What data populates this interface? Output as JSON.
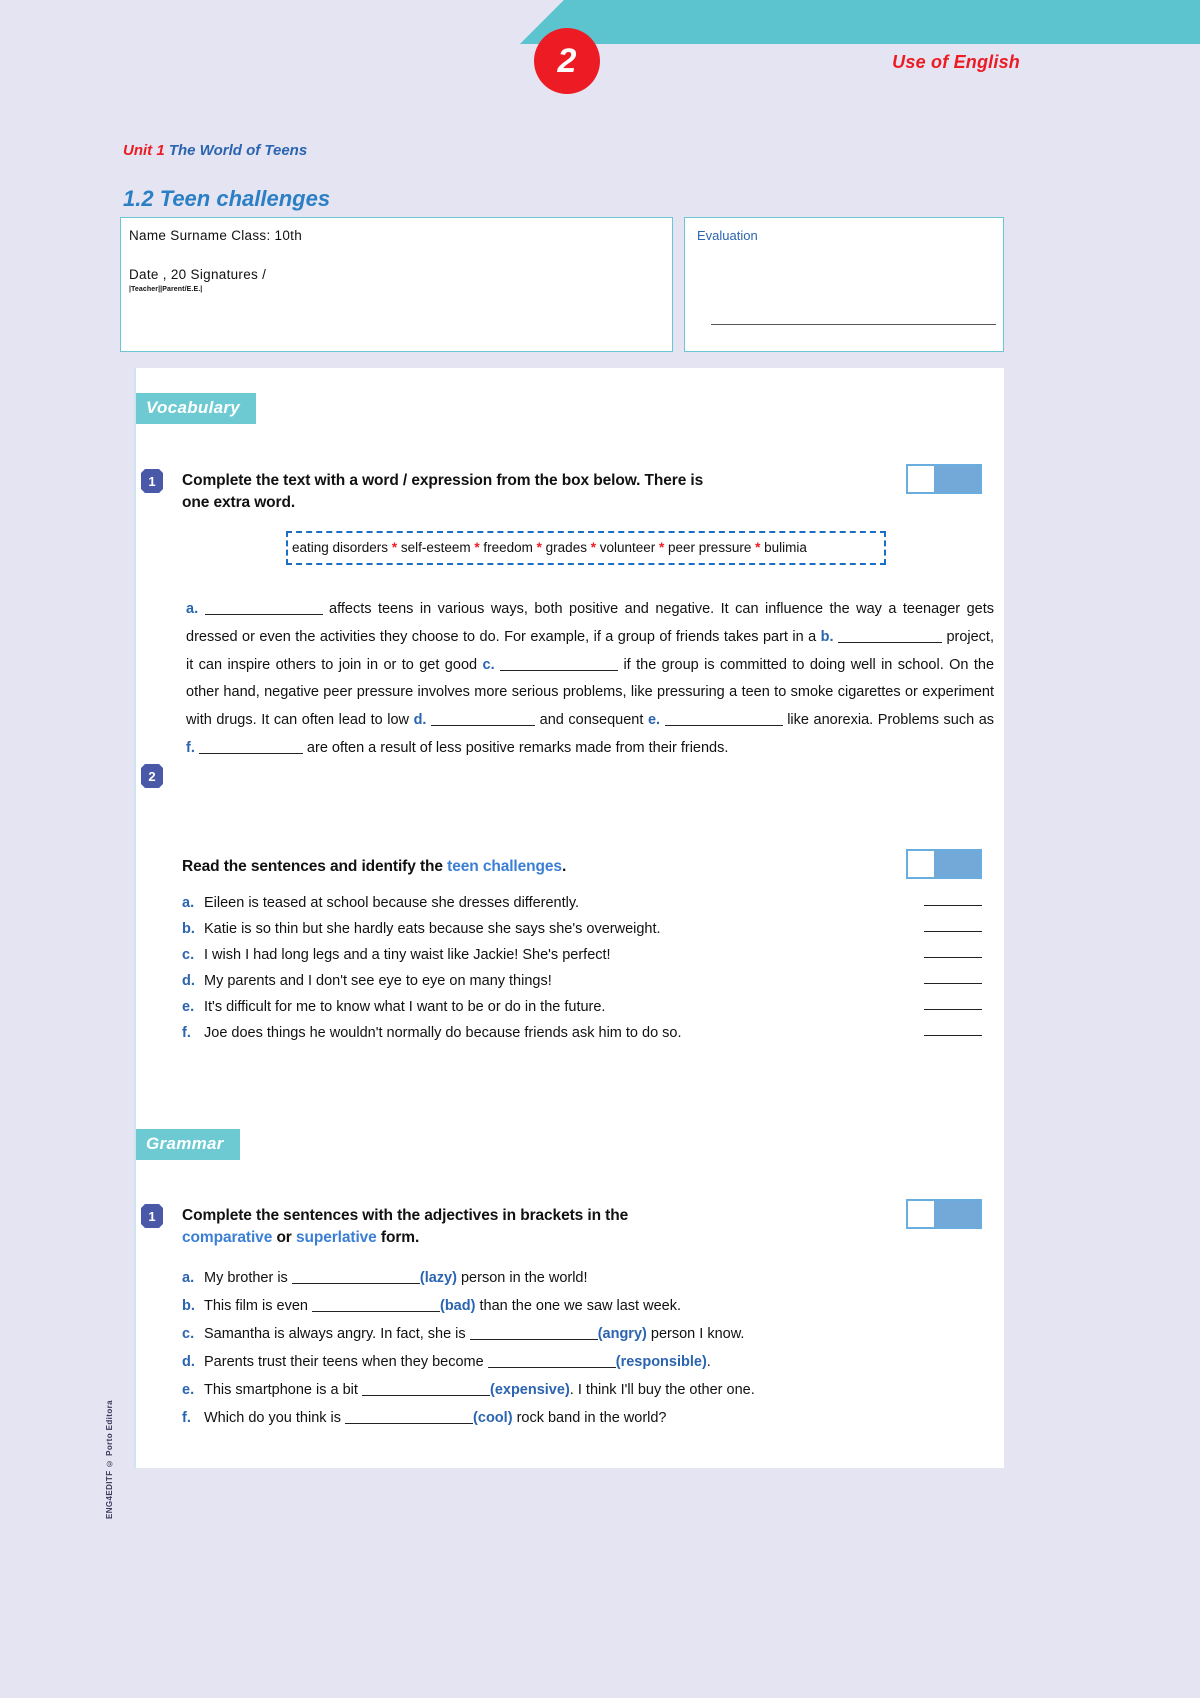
{
  "header": {
    "chapter_number": "2",
    "section_tag": "Use of English",
    "unit_number": "Unit 1",
    "unit_title": "The World of Teens",
    "lesson_title": "1.2 Teen challenges"
  },
  "name_box": {
    "line1": "Name  Surname  Class: 10th",
    "line2": "Date , 20  Signatures  /",
    "tiny": "|Teacher||Parent/E.E.|"
  },
  "eval_box": {
    "label": "Evaluation"
  },
  "sections": {
    "vocabulary": "Vocabulary",
    "grammar": "Grammar"
  },
  "vocab_ex1": {
    "number": "1",
    "instruction_line1": "Complete the text with a word / expression from the box below. There is",
    "instruction_line2": "one extra word.",
    "score": "/",
    "wordbank": [
      "eating disorders",
      "self-esteem",
      "freedom",
      "grades",
      "volunteer",
      "peer pressure",
      "bulimia"
    ],
    "wordbank_separator": "*",
    "cloze": {
      "a_label": "a.",
      "t1": "affects teens in various ways, both positive and negative. It can influence the way a teenager gets dressed or even the activities they choose to do. For example, if a group of friends takes part in a",
      "b_label": "b.",
      "t2": "project, it can inspire others to join in or to get good",
      "c_label": "c.",
      "t3": "if the group is committed to doing well in school. On the other hand, negative peer pressure involves more serious problems, like pressuring a teen to smoke cigarettes or experiment with drugs. It can often lead to low",
      "d_label": "d.",
      "t4": "and consequent",
      "e_label": "e.",
      "t5": "like anorexia. Problems such as",
      "f_label": "f.",
      "t6": "are often a result of less positive remarks made from their friends."
    }
  },
  "vocab_ex2": {
    "number": "2",
    "instruction_pre": "Read the sentences and identify the ",
    "instruction_hl": "teen challenges",
    "instruction_post": ".",
    "score": "/",
    "items": [
      {
        "label": "a.",
        "text": "Eileen is teased at school because she dresses differently."
      },
      {
        "label": "b.",
        "text": "Katie is so thin but she hardly eats because she says she's overweight."
      },
      {
        "label": "c.",
        "text": "I wish I had long legs and a tiny waist like Jackie! She's perfect!"
      },
      {
        "label": "d.",
        "text": "My parents and I don't see eye to eye on many things!"
      },
      {
        "label": "e.",
        "text": "It's difficult for me to know what I want to be or do in the future."
      },
      {
        "label": "f.",
        "text": "Joe does things he wouldn't normally do because friends ask him to do so."
      }
    ]
  },
  "grammar_ex1": {
    "number": "1",
    "instruction_line1": "Complete the sentences with the adjectives in brackets in the",
    "hl_comparative": "comparative",
    "instruction_or": " or ",
    "hl_superlative": "superlative",
    "instruction_end": " form.",
    "score": "/",
    "items": [
      {
        "label": "a.",
        "pre": "My brother is ",
        "adj": "(lazy)",
        "post": " person in the world!"
      },
      {
        "label": "b.",
        "pre": "This film is even ",
        "adj": "(bad)",
        "post": " than the one we saw last week."
      },
      {
        "label": "c.",
        "pre": "Samantha is always angry. In fact, she is ",
        "adj": "(angry)",
        "post": " person I know."
      },
      {
        "label": "d.",
        "pre": "Parents trust their teens when they become ",
        "adj": "(responsible)",
        "post": "."
      },
      {
        "label": "e.",
        "pre": "This smartphone is a bit ",
        "adj": "(expensive)",
        "post": ". I think I'll buy the other one."
      },
      {
        "label": "f.",
        "pre": "Which do you think is ",
        "adj": "(cool)",
        "post": " rock band in the world?"
      }
    ]
  },
  "watermark": "ENG4EDITF © Porto Editora",
  "colors": {
    "teal": "#5cc4ce",
    "red": "#ed1c24",
    "blue": "#2b64b0",
    "lesson_blue": "#2b7fc4",
    "chip_purple": "#4a58a8",
    "page_bg": "#e4e4f2"
  }
}
